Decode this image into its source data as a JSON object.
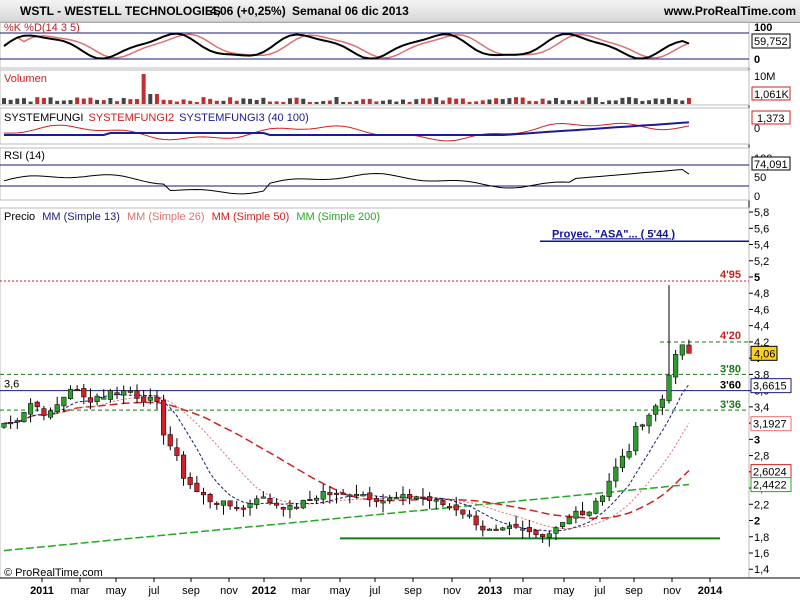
{
  "header": {
    "symbol": "WSTL - WESTELL TECHNOLOGIES",
    "price_change": "4,06 (+0,25%)",
    "period": "Semanal  06 dic 2013",
    "site": "www.ProRealTime.com"
  },
  "colors": {
    "background": "#ffffff",
    "up_candle": "#2e9b2e",
    "down_candle": "#d0202a",
    "mm13": "#1a1a7a",
    "mm26": "#e07070",
    "mm50": "#d02020",
    "mm200": "#22aa22",
    "band_line": "#1a1a7a",
    "proj_line": "#10109a",
    "guide_green": "#1a7a1a",
    "guide_red": "#cc2020"
  },
  "panels": {
    "stoch": {
      "label": "%K %D(14 3 5)",
      "levels": [
        "100",
        "0"
      ],
      "value": "59,752"
    },
    "volume": {
      "label": "Volumen",
      "levels": [
        "10M",
        "0"
      ],
      "value": "1,061K"
    },
    "systemfungi": {
      "label_parts": [
        "SYSTEMFUNGI",
        "SYSTEMFUNGI2",
        "SYSTEMFUNGI3 (40 100)"
      ],
      "levels": [
        "0"
      ],
      "value": "1,373"
    },
    "rsi": {
      "label": "RSI (14)",
      "levels": [
        "100",
        "50",
        "0"
      ],
      "value": "74,091"
    },
    "price": {
      "legend": {
        "prefix": "Precio",
        "mm13": "MM (Simple 13)",
        "mm26": "MM (Simple 26)",
        "mm50": "MM (Simple 50)",
        "mm200": "MM (Simple 200)"
      },
      "projection_label": "Proyec. \"ASA\"... ( 5'44 )",
      "level_labels": {
        "l495": "4'95",
        "l420": "4'20",
        "l380": "3'80",
        "l360": "3'60",
        "l336": "3'36",
        "left36": "3,6"
      },
      "value_badges": {
        "last": "4,06",
        "mm13": "3,6615",
        "mm26": "3,1927",
        "mm50": "2,6024",
        "mm200": "2,4422"
      },
      "copyright": "© ProRealTime.com"
    }
  },
  "x_axis": {
    "labels": [
      "2011",
      "mar",
      "may",
      "jul",
      "sep",
      "nov",
      "2012",
      "mar",
      "may",
      "jul",
      "sep",
      "nov",
      "2013",
      "mar",
      "may",
      "jul",
      "sep",
      "nov",
      "2014"
    ]
  },
  "chart_data": {
    "type": "candlestick",
    "title": "WSTL - WESTELL TECHNOLOGIES",
    "period": "weekly",
    "y_axis_ticks": [
      1.4,
      1.6,
      1.8,
      2,
      2.2,
      2.4,
      2.6,
      2.8,
      3,
      3.2,
      3.4,
      3.6,
      3.8,
      4,
      4.2,
      4.4,
      4.6,
      4.8,
      5,
      5.2,
      5.4,
      5.6,
      5.8
    ],
    "ylim": [
      1.4,
      5.8
    ],
    "x_tick_labels": [
      "2011",
      "mar",
      "may",
      "jul",
      "sep",
      "nov",
      "2012",
      "mar",
      "may",
      "jul",
      "sep",
      "nov",
      "2013",
      "mar",
      "may",
      "jul",
      "sep",
      "nov",
      "2014"
    ],
    "close_path": [
      [
        1,
        3.2
      ],
      [
        4,
        3.45
      ],
      [
        7,
        3.3
      ],
      [
        10,
        3.65
      ],
      [
        12,
        3.5
      ],
      [
        15,
        3.55
      ],
      [
        17,
        3.6
      ],
      [
        19,
        3.58
      ],
      [
        21,
        3.52
      ],
      [
        23,
        3.4
      ],
      [
        24,
        3.1
      ],
      [
        26,
        2.75
      ],
      [
        27,
        2.55
      ],
      [
        29,
        2.35
      ],
      [
        31,
        2.25
      ],
      [
        33,
        2.2
      ],
      [
        36,
        2.15
      ],
      [
        38,
        2.3
      ],
      [
        41,
        2.2
      ],
      [
        43,
        2.15
      ],
      [
        46,
        2.25
      ],
      [
        48,
        2.35
      ],
      [
        50,
        2.3
      ],
      [
        53,
        2.35
      ],
      [
        55,
        2.3
      ],
      [
        57,
        2.25
      ],
      [
        60,
        2.28
      ],
      [
        62,
        2.3
      ],
      [
        64,
        2.25
      ],
      [
        66,
        2.2
      ],
      [
        68,
        2.15
      ],
      [
        70,
        2.05
      ],
      [
        72,
        1.9
      ],
      [
        74,
        1.85
      ],
      [
        76,
        1.9
      ],
      [
        78,
        1.88
      ],
      [
        80,
        1.82
      ],
      [
        82,
        1.85
      ],
      [
        84,
        2.0
      ],
      [
        86,
        2.1
      ],
      [
        87,
        2.05
      ],
      [
        89,
        2.2
      ],
      [
        91,
        2.5
      ],
      [
        93,
        2.8
      ],
      [
        94,
        2.9
      ],
      [
        95,
        3.1
      ],
      [
        97,
        3.25
      ],
      [
        98,
        3.4
      ],
      [
        99,
        3.5
      ],
      [
        100,
        3.85
      ],
      [
        101,
        4.0
      ],
      [
        102,
        4.1
      ],
      [
        103,
        4.15
      ]
    ],
    "price_levels": {
      "projection_ASA": 5.44,
      "resistance": 4.95,
      "level_420": 4.2,
      "level_380": 3.8,
      "level_360": 3.6,
      "level_336": 3.36,
      "support_low": 1.78
    },
    "last_values": {
      "price": 4.06,
      "mm13": 3.6615,
      "mm26": 3.1927,
      "mm50": 2.6024,
      "mm200": 2.4422
    },
    "indicators": {
      "stochastic_K": 59.752,
      "volume": "1,061K",
      "systemfungi": 1.373,
      "rsi14": 74.091
    }
  }
}
